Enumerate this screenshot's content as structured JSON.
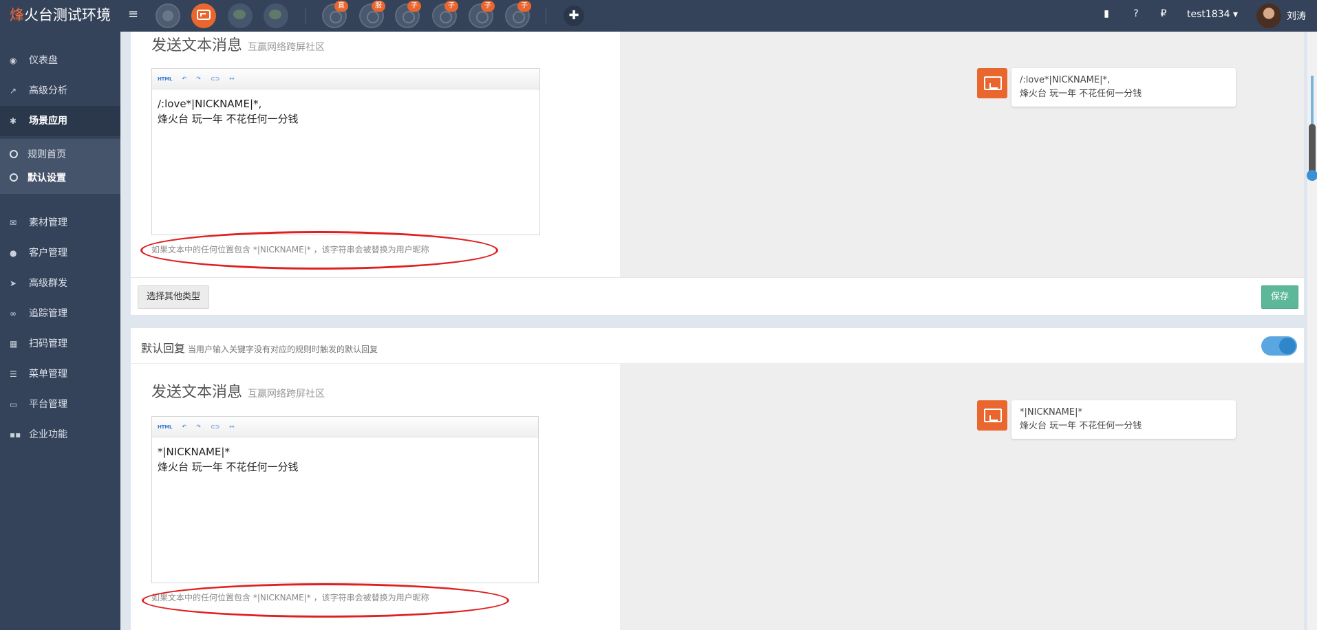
{
  "app": {
    "title_first": "烽",
    "title_rest": "火台测试环境"
  },
  "topbar": {
    "hamburger_icon": "≡",
    "badges": [
      "直",
      "服",
      "子",
      "子",
      "子",
      "子"
    ],
    "plus_icon": "✚",
    "book_icon": "▮",
    "help_icon": "?",
    "p_icon": "₽",
    "username": "test1834 ▾",
    "real_name": "刘涛"
  },
  "sidebar": {
    "items": [
      {
        "label": "仪表盘",
        "icon": "dashboard-icon"
      },
      {
        "label": "高级分析",
        "icon": "chart-icon"
      },
      {
        "label": "场景应用",
        "icon": "gear-icon"
      },
      {
        "label": "素材管理",
        "icon": "envelope-icon"
      },
      {
        "label": "客户管理",
        "icon": "user-icon"
      },
      {
        "label": "高级群发",
        "icon": "send-icon"
      },
      {
        "label": "追踪管理",
        "icon": "link-icon"
      },
      {
        "label": "扫码管理",
        "icon": "qrcode-icon"
      },
      {
        "label": "菜单管理",
        "icon": "list-icon"
      },
      {
        "label": "平台管理",
        "icon": "monitor-icon"
      },
      {
        "label": "企业功能",
        "icon": "grid-icon"
      }
    ],
    "subitems": [
      {
        "label": "规则首页"
      },
      {
        "label": "默认设置"
      }
    ]
  },
  "panel1": {
    "title": "发送文本消息",
    "subtitle": "互赢网络跨屏社区",
    "toolbar": {
      "html": "HTML",
      "undo": "↶",
      "redo": "↷",
      "link": "⊂⊃",
      "unlink": "⚯"
    },
    "editor_line1": "/:love*|NICKNAME|*,",
    "editor_line2": "烽火台 玩一年 不花任何一分钱",
    "hint": "如果文本中的任何位置包含 *|NICKNAME|* ，该字符串会被替换为用户昵称",
    "preview_line1": "/:love*|NICKNAME|*,",
    "preview_line2": "烽火台 玩一年 不花任何一分钱",
    "btn_other": "选择其他类型",
    "btn_save": "保存"
  },
  "panel2": {
    "header_title": "默认回复",
    "header_desc": "当用户输入关键字没有对应的规则时触发的默认回复",
    "title": "发送文本消息",
    "subtitle": "互赢网络跨屏社区",
    "toolbar": {
      "html": "HTML",
      "undo": "↶",
      "redo": "↷",
      "link": "⊂⊃",
      "unlink": "⚯"
    },
    "editor_line1": "*|NICKNAME|*",
    "editor_line2": "烽火台 玩一年 不花任何一分钱",
    "hint": "如果文本中的任何位置包含 *|NICKNAME|* ，该字符串会被替换为用户昵称",
    "preview_line1": "*|NICKNAME|*",
    "preview_line2": "烽火台 玩一年 不花任何一分钱",
    "toggle_on": true
  },
  "colors": {
    "accent": "#e9662f",
    "sidebar": "#35435a",
    "save": "#5cb898",
    "annotation": "#e02020"
  }
}
